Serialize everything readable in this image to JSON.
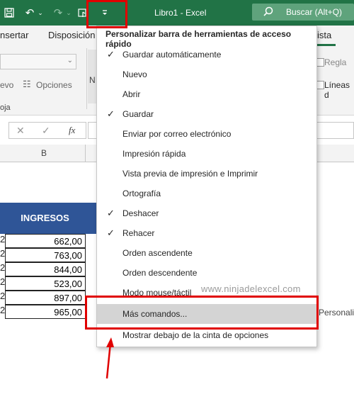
{
  "titlebar": {
    "doc_title": "Libro1  -  Excel",
    "search_label": "Buscar (Alt+Q)"
  },
  "ribbon": {
    "tabs": [
      "nsertar",
      "Disposición",
      "ista"
    ],
    "labels": {
      "evo": "evo",
      "opciones": "Opciones",
      "oja": "oja",
      "n": "N",
      "regla": "Regla",
      "lineas": "Líneas d"
    }
  },
  "formula_bar": {
    "fx": "fx"
  },
  "grid": {
    "column_b": "B",
    "header": "INGRESOS",
    "row_prefix": "2",
    "values": [
      "662,00",
      "763,00",
      "844,00",
      "523,00",
      "897,00",
      "965,00"
    ],
    "side_text": "Personaliz"
  },
  "menu": {
    "title": "Personalizar barra de herramientas de acceso rápido",
    "items": [
      {
        "label": "Guardar automáticamente",
        "checked": true
      },
      {
        "label": "Nuevo",
        "checked": false
      },
      {
        "label": "Abrir",
        "checked": false
      },
      {
        "label": "Guardar",
        "checked": true
      },
      {
        "label": "Enviar por correo electrónico",
        "checked": false
      },
      {
        "label": "Impresión rápida",
        "checked": false
      },
      {
        "label": "Vista previa de impresión e Imprimir",
        "checked": false
      },
      {
        "label": "Ortografía",
        "checked": false
      },
      {
        "label": "Deshacer",
        "checked": true
      },
      {
        "label": "Rehacer",
        "checked": true
      },
      {
        "label": "Orden ascendente",
        "checked": false
      },
      {
        "label": "Orden descendente",
        "checked": false
      },
      {
        "label": "Modo mouse/táctil",
        "checked": false
      },
      {
        "label": "Más comandos...",
        "checked": false,
        "highlighted": true
      },
      {
        "label": "Mostrar debajo de la cinta de opciones",
        "checked": false
      }
    ],
    "check_glyph": "✓"
  },
  "watermark": "www.ninjadelexcel.com",
  "colors": {
    "excel_green": "#217346",
    "header_blue": "#2f5597",
    "annotation_red": "#e00000"
  }
}
